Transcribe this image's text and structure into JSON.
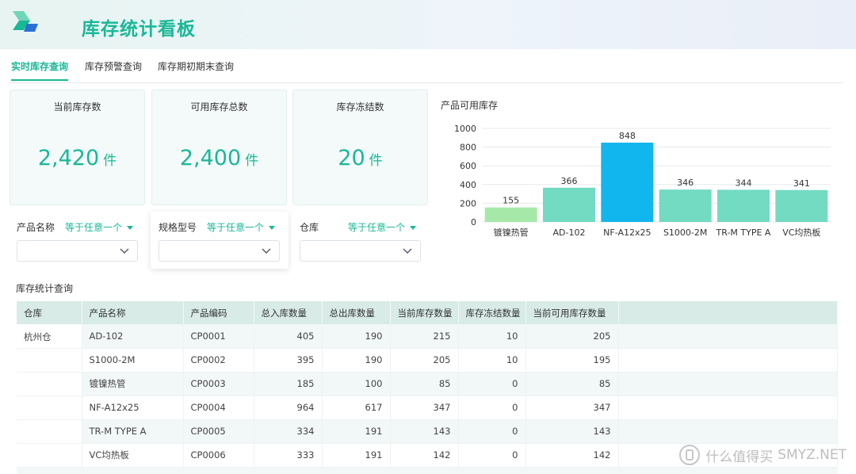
{
  "app": {
    "title": "库存统计看板",
    "logo_icon": "app-logo-icon"
  },
  "tabs": [
    {
      "label": "实时库存查询",
      "active": true
    },
    {
      "label": "库存预警查询",
      "active": false
    },
    {
      "label": "库存期初期末查询",
      "active": false
    }
  ],
  "cards": [
    {
      "title": "当前库存数",
      "value": "2,420",
      "unit": "件"
    },
    {
      "title": "可用库存总数",
      "value": "2,400",
      "unit": "件"
    },
    {
      "title": "库存冻结数",
      "value": "20",
      "unit": "件"
    }
  ],
  "filters": [
    {
      "label": "产品名称",
      "operator": "等于任意一个",
      "value": "",
      "icon": "chevron-down-icon"
    },
    {
      "label": "规格型号",
      "operator": "等于任意一个",
      "value": "",
      "icon": "chevron-down-icon"
    },
    {
      "label": "仓库",
      "operator": "等于任意一个",
      "value": "",
      "icon": "chevron-down-icon"
    }
  ],
  "chart_data": {
    "type": "bar",
    "title": "产品可用库存",
    "categories": [
      "镀镍热管",
      "AD-102",
      "NF-A12x25",
      "S1000-2M",
      "TR-M TYPE A",
      "VC均热板"
    ],
    "values": [
      155,
      366,
      848,
      346,
      344,
      341
    ],
    "ylim": [
      0,
      1000
    ],
    "yticks": [
      0,
      200,
      400,
      600,
      800,
      1000
    ],
    "grid": true,
    "bar_colors": [
      "#a6e8a8",
      "#72dbc2",
      "#11b6ee",
      "#72dbc2",
      "#72dbc2",
      "#72dbc2"
    ]
  },
  "table": {
    "title": "库存统计查询",
    "columns": [
      "仓库",
      "产品名称",
      "产品编码",
      "总入库数量",
      "总出库数量",
      "当前库存数量",
      "库存冻结数量",
      "当前可用库存数量"
    ],
    "warehouse": "杭州仓",
    "rows": [
      [
        "AD-102",
        "CP0001",
        "405",
        "190",
        "215",
        "10",
        "205"
      ],
      [
        "S1000-2M",
        "CP0002",
        "395",
        "190",
        "205",
        "10",
        "195"
      ],
      [
        "镀镍热管",
        "CP0003",
        "185",
        "100",
        "85",
        "0",
        "85"
      ],
      [
        "NF-A12x25",
        "CP0004",
        "964",
        "617",
        "347",
        "0",
        "347"
      ],
      [
        "TR-M TYPE A",
        "CP0005",
        "334",
        "191",
        "143",
        "0",
        "143"
      ],
      [
        "VC均热板",
        "CP0006",
        "333",
        "191",
        "142",
        "0",
        "142"
      ]
    ]
  },
  "watermark": {
    "text": "什么值得买",
    "sub": "SMYZ.NET",
    "icon": "smzdm-seal-icon"
  },
  "colors": {
    "accent": "#19b896",
    "header_bg": "#e7f4f1",
    "table_header": "#d8ebe7"
  }
}
